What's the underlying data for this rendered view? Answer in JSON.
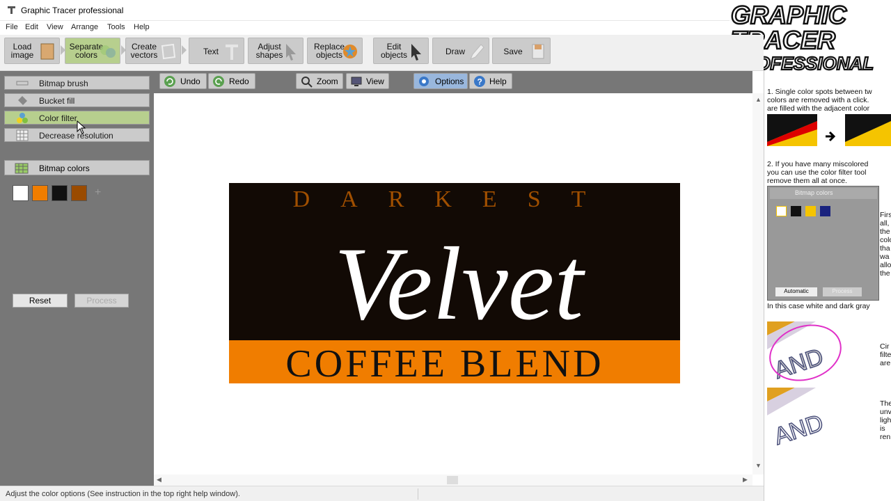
{
  "window": {
    "title": "Graphic Tracer professional"
  },
  "menu": {
    "items": [
      "File",
      "Edit",
      "View",
      "Arrange",
      "Tools",
      "Help"
    ]
  },
  "toolbar": {
    "buttons": [
      {
        "label": "Load\nimage"
      },
      {
        "label": "Separate\ncolors"
      },
      {
        "label": "Create\nvectors"
      },
      {
        "label": "Text"
      },
      {
        "label": "Adjust\nshapes"
      },
      {
        "label": "Replace\nobjects"
      },
      {
        "label": "Edit\nobjects"
      },
      {
        "label": "Draw"
      },
      {
        "label": "Save"
      }
    ]
  },
  "left_panel": {
    "tools": [
      {
        "label": "Bitmap brush",
        "icon": "brush-icon"
      },
      {
        "label": "Bucket fill",
        "icon": "bucket-icon"
      },
      {
        "label": "Color filter",
        "icon": "color-filter-icon"
      },
      {
        "label": "Decrease resolution",
        "icon": "grid-icon"
      }
    ],
    "bitmap_colors_label": "Bitmap colors",
    "swatches": [
      "#ffffff",
      "#f07d00",
      "#111111",
      "#9a4b00"
    ],
    "swatch_add": "+",
    "reset_label": "Reset",
    "process_label": "Process"
  },
  "canvas_toolbar": {
    "undo": "Undo",
    "redo": "Redo",
    "zoom": "Zoom",
    "view": "View",
    "options": "Options",
    "help": "Help"
  },
  "canvas": {
    "logo_top": "DARKEST",
    "logo_script": "Velvet",
    "logo_bottom": "COFFEE BLEND"
  },
  "help_panel": {
    "step1": [
      "1. Single color spots between tw",
      "colors are removed with a click.",
      "are filled with the adjacent color"
    ],
    "step2": [
      "2. If you have many miscolored",
      "you can use the color filter tool",
      "remove them all at once."
    ],
    "mini_panel_title": "Bitmap colors",
    "mini_auto": "Automatic",
    "mini_process": "Process",
    "side_text_1": [
      "Firs",
      "all,",
      "the",
      "colo",
      "tha",
      "wa",
      "allo",
      "the"
    ],
    "caption": "In this case white and dark gray",
    "side_text_2": [
      "Cir",
      "filte",
      "are"
    ],
    "side_text_3": [
      "The",
      "unv",
      "ligh",
      "is",
      "ren"
    ],
    "sample_word": "AND"
  },
  "brand": {
    "line1": "GRAPHIC",
    "line2": "TRACER",
    "line3": "PROFESSIONAL"
  },
  "status": {
    "text": "Adjust the color options (See instruction in the top right help window)."
  },
  "colors": {
    "active_green": "#b7cf8e",
    "active_blue": "#99b7dd",
    "orange": "#f07d00",
    "panel_gray": "#777777"
  }
}
